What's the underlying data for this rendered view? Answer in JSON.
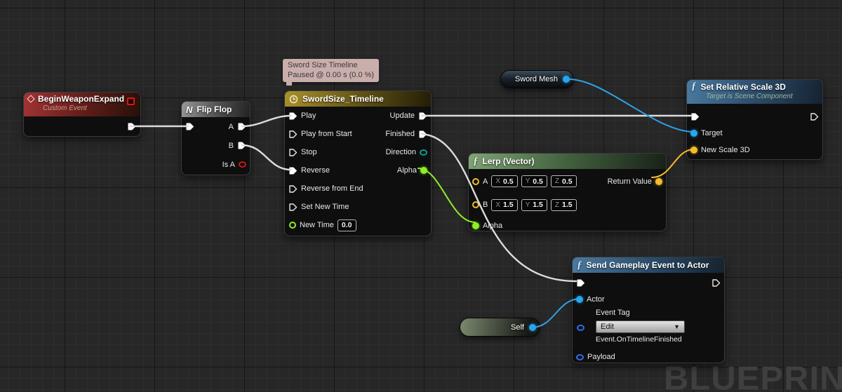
{
  "watermark": {
    "text": "BLUEPRINT"
  },
  "tooltip": {
    "line1": "Sword Size Timeline",
    "line2": "Paused @ 0.00 s (0.0 %)"
  },
  "icons": {
    "function_glyph": "ƒ",
    "flipflop_glyph": "N",
    "dropdown_arrow": "▼"
  },
  "nodes": {
    "begin": {
      "title": "BeginWeaponExpand",
      "subtitle": "Custom Event"
    },
    "flipflop": {
      "title": "Flip Flop",
      "pin_a": "A",
      "pin_b": "B",
      "pin_isa": "Is A"
    },
    "timeline": {
      "title": "SwordSize_Timeline",
      "inputs": [
        "Play",
        "Play from Start",
        "Stop",
        "Reverse",
        "Reverse from End",
        "Set New Time"
      ],
      "new_time_label": "New Time",
      "new_time_value": "0.0",
      "outputs": [
        "Update",
        "Finished",
        "Direction",
        "Alpha"
      ]
    },
    "lerp": {
      "title": "Lerp (Vector)",
      "pin_a": "A",
      "pin_b": "B",
      "axis_labels": [
        "X",
        "Y",
        "Z"
      ],
      "a_values": [
        "0.5",
        "0.5",
        "0.5"
      ],
      "b_values": [
        "1.5",
        "1.5",
        "1.5"
      ],
      "alpha_label": "Alpha",
      "return_label": "Return Value"
    },
    "scale": {
      "title": "Set Relative Scale 3D",
      "subtitle": "Target is Scene Component",
      "target_label": "Target",
      "new_scale_label": "New Scale 3D"
    },
    "send": {
      "title": "Send Gameplay Event to Actor",
      "actor_label": "Actor",
      "event_tag_label": "Event Tag",
      "dropdown_value": "Edit",
      "tag_value": "Event.OnTimelineFinished",
      "payload_label": "Payload"
    },
    "sword_mesh": {
      "label": "Sword Mesh"
    },
    "self_node": {
      "label": "Self"
    }
  },
  "colors": {
    "canvas_bg": "#272727",
    "header_event_red": "#a23434",
    "header_timeline_gold": "#a8912a",
    "header_function_green": "#7fa477",
    "header_function_blue": "#4a7aa0",
    "wire_exec": "#dcdcdc",
    "wire_float_green": "#8cef25",
    "wire_vector_gold": "#f2bc2e",
    "wire_object_blue": "#2fa3ea",
    "pin_bool_red": "#cb1414",
    "pin_enum_teal": "#0f9a90",
    "pin_struct_blue": "#2f6cee"
  }
}
